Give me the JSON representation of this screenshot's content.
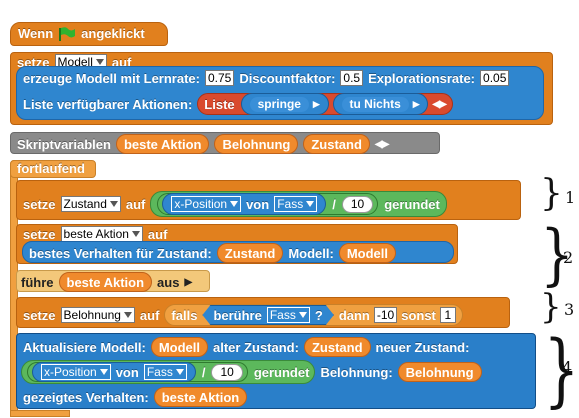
{
  "hat": {
    "when": "Wenn",
    "clicked": "angeklickt",
    "flag_color": "#2fb32f"
  },
  "set_model": {
    "set": "setze",
    "var": "Modell",
    "to": "auf"
  },
  "create_model": {
    "label": "erzeuge Modell mit Lernrate:",
    "lr": "0.75",
    "discount_label": "Discountfaktor:",
    "discount": "0.5",
    "explore_label": "Explorationsrate:",
    "explore": "0.05"
  },
  "actions": {
    "label": "Liste verfügbarer Aktionen:",
    "list": "Liste",
    "item1": "springe",
    "item2": "tu Nichts"
  },
  "script_vars": {
    "label": "Skriptvariablen",
    "v1": "beste Aktion",
    "v2": "Belohnung",
    "v3": "Zustand"
  },
  "forever": "fortlaufend",
  "set_state": {
    "set": "setze",
    "var": "Zustand",
    "to": "auf",
    "xpos": "x-Position",
    "of": "von",
    "sprite": "Fass",
    "div": "/",
    "divisor": "10",
    "round": "gerundet"
  },
  "set_best": {
    "set": "setze",
    "var": "beste Aktion",
    "to": "auf",
    "label": "bestes Verhalten für Zustand:",
    "state": "Zustand",
    "model_label": "Modell:",
    "model": "Modell"
  },
  "run": {
    "label": "führe",
    "var": "beste Aktion",
    "suffix": "aus"
  },
  "set_reward": {
    "set": "setze",
    "var": "Belohnung",
    "to": "auf",
    "if": "falls",
    "touch": "berühre",
    "sprite": "Fass",
    "q": "?",
    "then": "dann",
    "then_val": "-10",
    "else": "sonst",
    "else_val": "1"
  },
  "update": {
    "label": "Aktualisiere Modell:",
    "model": "Modell",
    "old_label": "alter Zustand:",
    "old": "Zustand",
    "new_label": "neuer Zustand:",
    "xpos": "x-Position",
    "of": "von",
    "sprite": "Fass",
    "div": "/",
    "divisor": "10",
    "round": "gerundet",
    "reward_label": "Belohnung:",
    "reward": "Belohnung",
    "shown_label": "gezeigtes Verhalten:",
    "shown": "beste Aktion"
  },
  "annotations": {
    "n1": "1",
    "n2": "2",
    "n3": "3",
    "n4": "4"
  }
}
